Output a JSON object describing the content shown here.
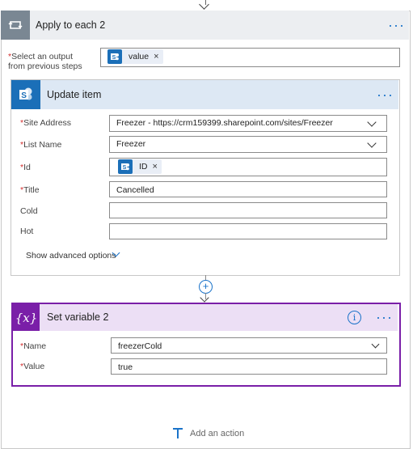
{
  "apply_each": {
    "title": "Apply to each 2",
    "more_label": "···",
    "select_output_label_line1": "Select an output",
    "select_output_label_line2": "from previous steps",
    "token": {
      "label": "value",
      "remove": "×"
    }
  },
  "update_item": {
    "title": "Update item",
    "more_label": "···",
    "fields": {
      "site_address": {
        "label": "Site Address",
        "value": "Freezer - https://crm159399.sharepoint.com/sites/Freezer"
      },
      "list_name": {
        "label": "List Name",
        "value": "Freezer"
      },
      "id": {
        "label": "Id",
        "token_label": "ID",
        "token_remove": "×"
      },
      "title": {
        "label": "Title",
        "value": "Cancelled"
      },
      "cold": {
        "label": "Cold",
        "value": ""
      },
      "hot": {
        "label": "Hot",
        "value": ""
      }
    },
    "show_advanced": "Show advanced options"
  },
  "connector": {
    "plus": "+"
  },
  "set_variable": {
    "icon_text": "{x}",
    "title": "Set variable 2",
    "info": "i",
    "more_label": "···",
    "name": {
      "label": "Name",
      "value": "freezerCold"
    },
    "value": {
      "label": "Value",
      "value": "true"
    }
  },
  "footer": {
    "add_action": "Add an action"
  },
  "colors": {
    "accent_blue": "#1a73c9",
    "sharepoint_blue": "#1b6fb8",
    "variable_purple": "#7a1fa8",
    "required_red": "#d32f2f"
  },
  "star": "*"
}
